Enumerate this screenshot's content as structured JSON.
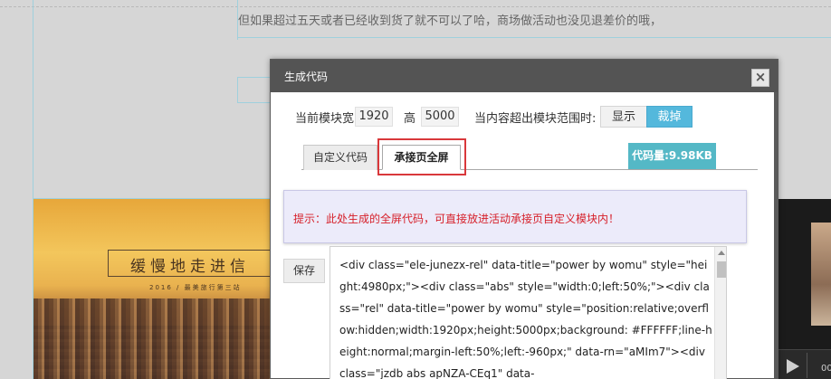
{
  "background": {
    "notice_text": "但如果超过五天或者已经收到货了就不可以了哈，商场做活动也没见退差价的哦，",
    "banner_title": "缓慢地走进信",
    "banner_subtitle": "2016 / 最美旅行第三站",
    "video_time": "00"
  },
  "dialog": {
    "title": "生成代码",
    "close_glyph": "×",
    "width_label": "当前模块宽",
    "width_value": "1920",
    "height_label": "高",
    "height_value": "5000",
    "overflow_label": "当内容超出模块范围时:",
    "overflow_options": {
      "show": "显示",
      "cut": "裁掉"
    },
    "overflow_selected": "裁掉",
    "tabs": {
      "custom": "自定义代码",
      "landing": "承接页全屏"
    },
    "active_tab": "承接页全屏",
    "code_size": "代码量:9.98KB",
    "tip": "提示：此处生成的全屏代码，可直接放进活动承接页自定义模块内！",
    "save_label": "保存",
    "code": "<div class=\"ele-junezx-rel\" data-title=\"power by womu\" style=\"height:4980px;\"><div class=\"abs\" style=\"width:0;left:50%;\"><div class=\"rel\" data-title=\"power by womu\" style=\"position:relative;overflow:hidden;width:1920px;height:5000px;background: #FFFFFF;line-height:normal;margin-left:50%;left:-960px;\" data-rn=\"aMIm7\"><div class=\"jzdb abs apNZA-CEq1\" data-"
  },
  "colors": {
    "header_bg": "#545454",
    "accent_blue": "#54b8dc",
    "code_size_bg": "#54b8c6",
    "tip_bg": "#ecebfa",
    "tip_text": "#d6202a",
    "highlight_border": "#d9383b"
  }
}
